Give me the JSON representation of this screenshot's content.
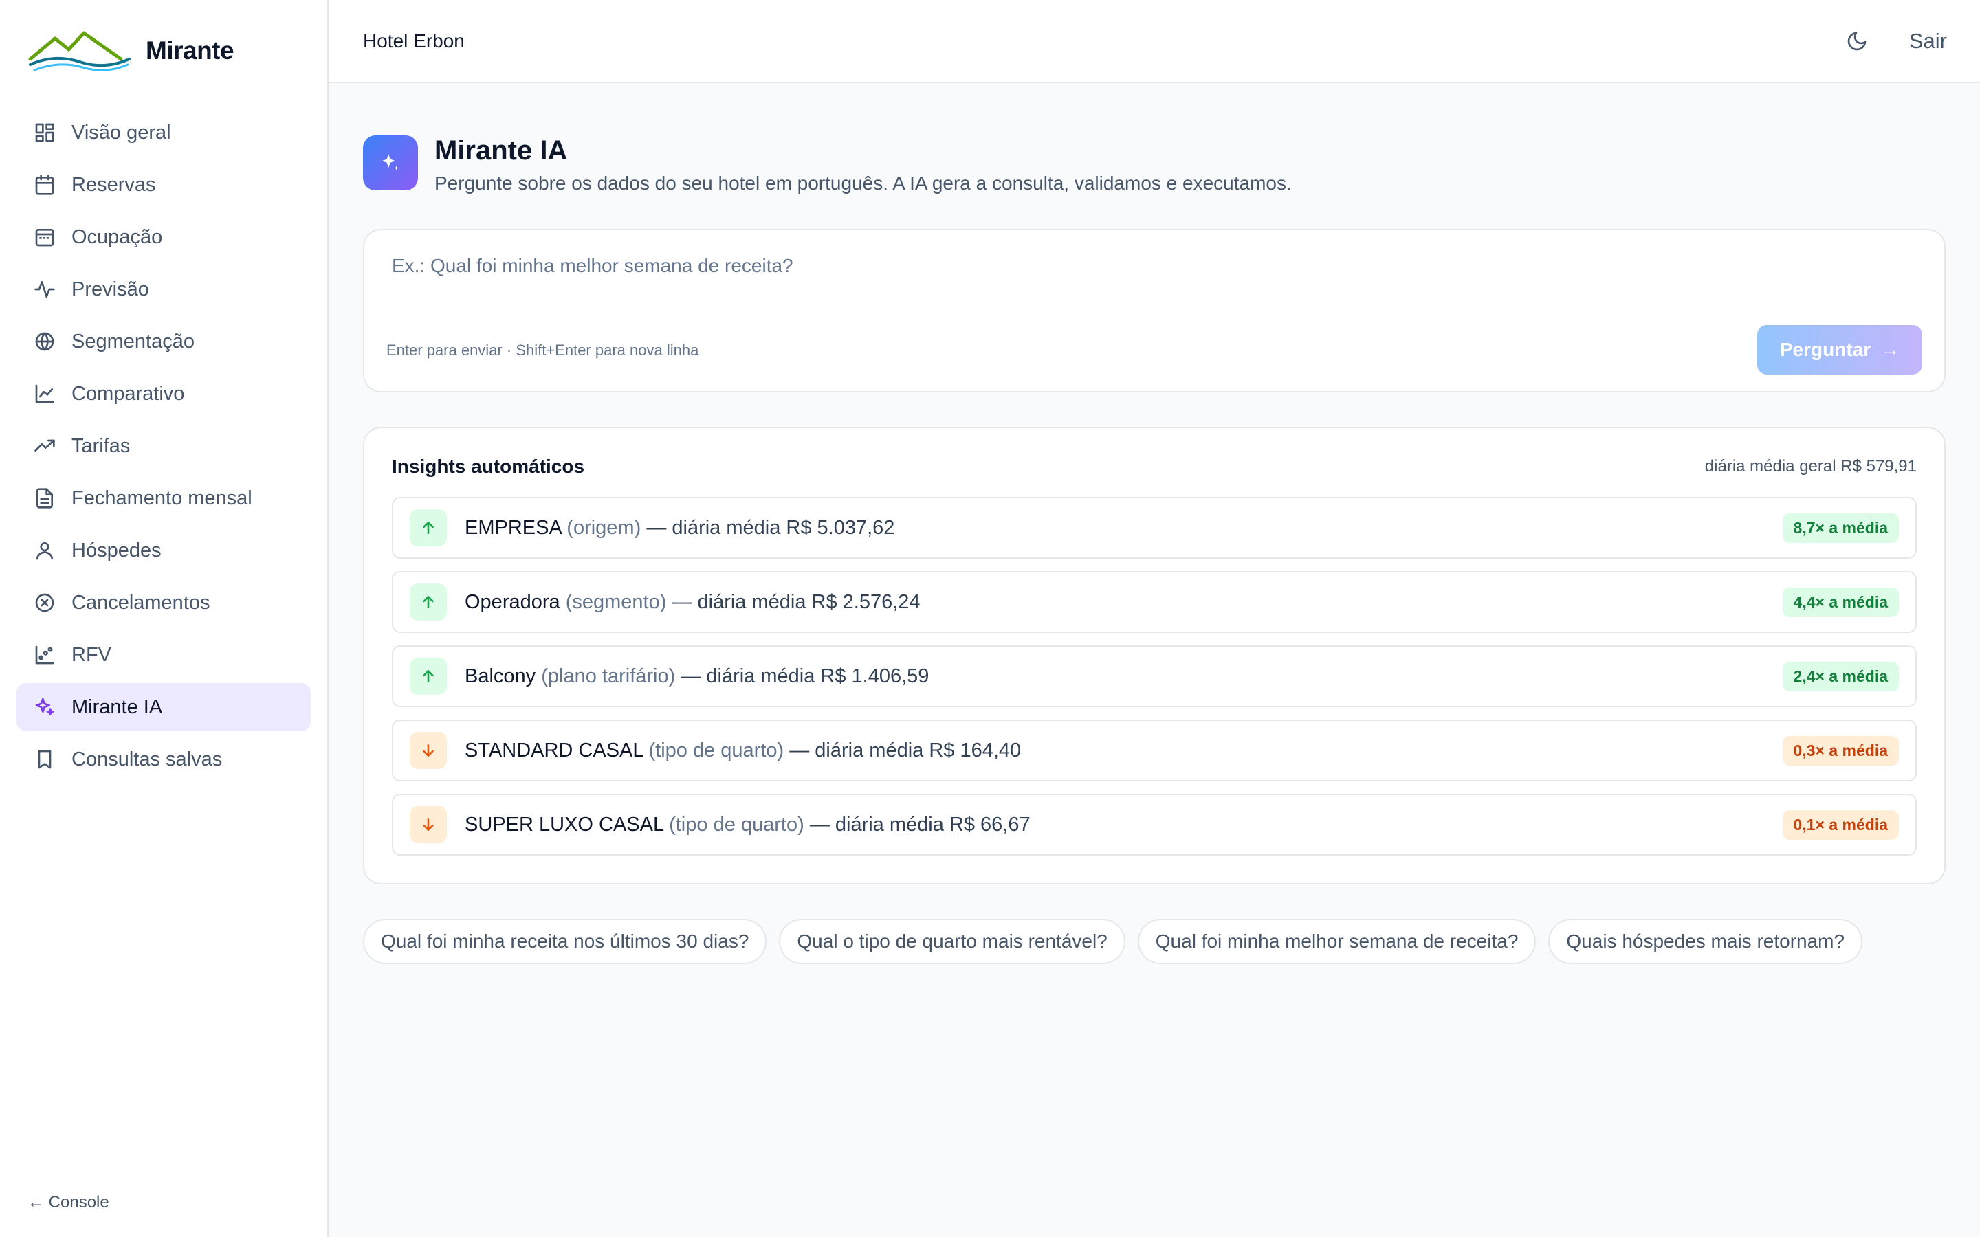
{
  "brand": {
    "name": "Mirante"
  },
  "sidebar": {
    "items": [
      {
        "label": "Visão geral",
        "icon": "dashboard-grid-icon"
      },
      {
        "label": "Reservas",
        "icon": "calendar-icon"
      },
      {
        "label": "Ocupação",
        "icon": "calendar-grid-icon"
      },
      {
        "label": "Previsão",
        "icon": "pulse-icon"
      },
      {
        "label": "Segmentação",
        "icon": "globe-icon"
      },
      {
        "label": "Comparativo",
        "icon": "line-chart-icon"
      },
      {
        "label": "Tarifas",
        "icon": "trending-up-icon"
      },
      {
        "label": "Fechamento mensal",
        "icon": "file-icon"
      },
      {
        "label": "Hóspedes",
        "icon": "user-icon"
      },
      {
        "label": "Cancelamentos",
        "icon": "x-circle-icon"
      },
      {
        "label": "RFV",
        "icon": "scatter-icon"
      },
      {
        "label": "Mirante IA",
        "icon": "sparkles-icon",
        "active": true
      },
      {
        "label": "Consultas salvas",
        "icon": "bookmark-icon"
      }
    ],
    "console_link": "← Console"
  },
  "topbar": {
    "hotel": "Hotel Erbon",
    "logout": "Sair"
  },
  "page": {
    "title": "Mirante IA",
    "subtitle": "Pergunte sobre os dados do seu hotel em português. A IA gera a consulta, validamos e executamos."
  },
  "ask": {
    "placeholder": "Ex.: Qual foi minha melhor semana de receita?",
    "value": "",
    "hint": "Enter para enviar · Shift+Enter para nova linha",
    "button": "Perguntar"
  },
  "insights": {
    "title": "Insights automáticos",
    "average": "diária média geral R$ 579,91",
    "rows": [
      {
        "name": "EMPRESA",
        "kind": "(origem)",
        "text": "— diária média R$ 5.037,62",
        "ratio": "8,7× a média",
        "direction": "up"
      },
      {
        "name": "Operadora",
        "kind": "(segmento)",
        "text": "— diária média R$ 2.576,24",
        "ratio": "4,4× a média",
        "direction": "up"
      },
      {
        "name": "Balcony",
        "kind": "(plano tarifário)",
        "text": "— diária média R$ 1.406,59",
        "ratio": "2,4× a média",
        "direction": "up"
      },
      {
        "name": "STANDARD CASAL",
        "kind": "(tipo de quarto)",
        "text": "— diária média R$ 164,40",
        "ratio": "0,3× a média",
        "direction": "down"
      },
      {
        "name": "SUPER LUXO CASAL",
        "kind": "(tipo de quarto)",
        "text": "— diária média R$ 66,67",
        "ratio": "0,1× a média",
        "direction": "down"
      }
    ]
  },
  "suggestions": [
    "Qual foi minha receita nos últimos 30 dias?",
    "Qual o tipo de quarto mais rentável?",
    "Qual foi minha melhor semana de receita?",
    "Quais hóspedes mais retornam?"
  ],
  "colors": {
    "accent": "#7c3aed",
    "up": "#16a34a",
    "down": "#ea580c",
    "active_bg": "#ede9fe"
  }
}
